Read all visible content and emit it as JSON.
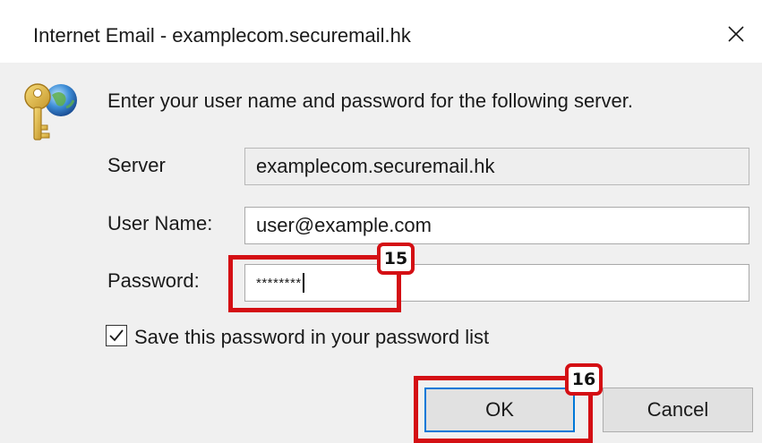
{
  "window": {
    "title": "Internet Email - examplecom.securemail.hk"
  },
  "dialog": {
    "prompt": "Enter your user name and password for the following server.",
    "icon": "key-globe-icon",
    "server": {
      "label": "Server",
      "value": "examplecom.securemail.hk"
    },
    "username": {
      "label": "User Name:",
      "value": "user@example.com"
    },
    "password": {
      "label": "Password:",
      "value": "********"
    },
    "save_password": {
      "label": "Save this password in your password list",
      "checked": true
    },
    "ok_label": "OK",
    "cancel_label": "Cancel"
  },
  "annotations": {
    "step_password": "15",
    "step_ok": "16",
    "highlight_color": "#d40f14"
  },
  "colors": {
    "focus_border": "#0078d7",
    "dialog_background": "#f0f0f0"
  }
}
